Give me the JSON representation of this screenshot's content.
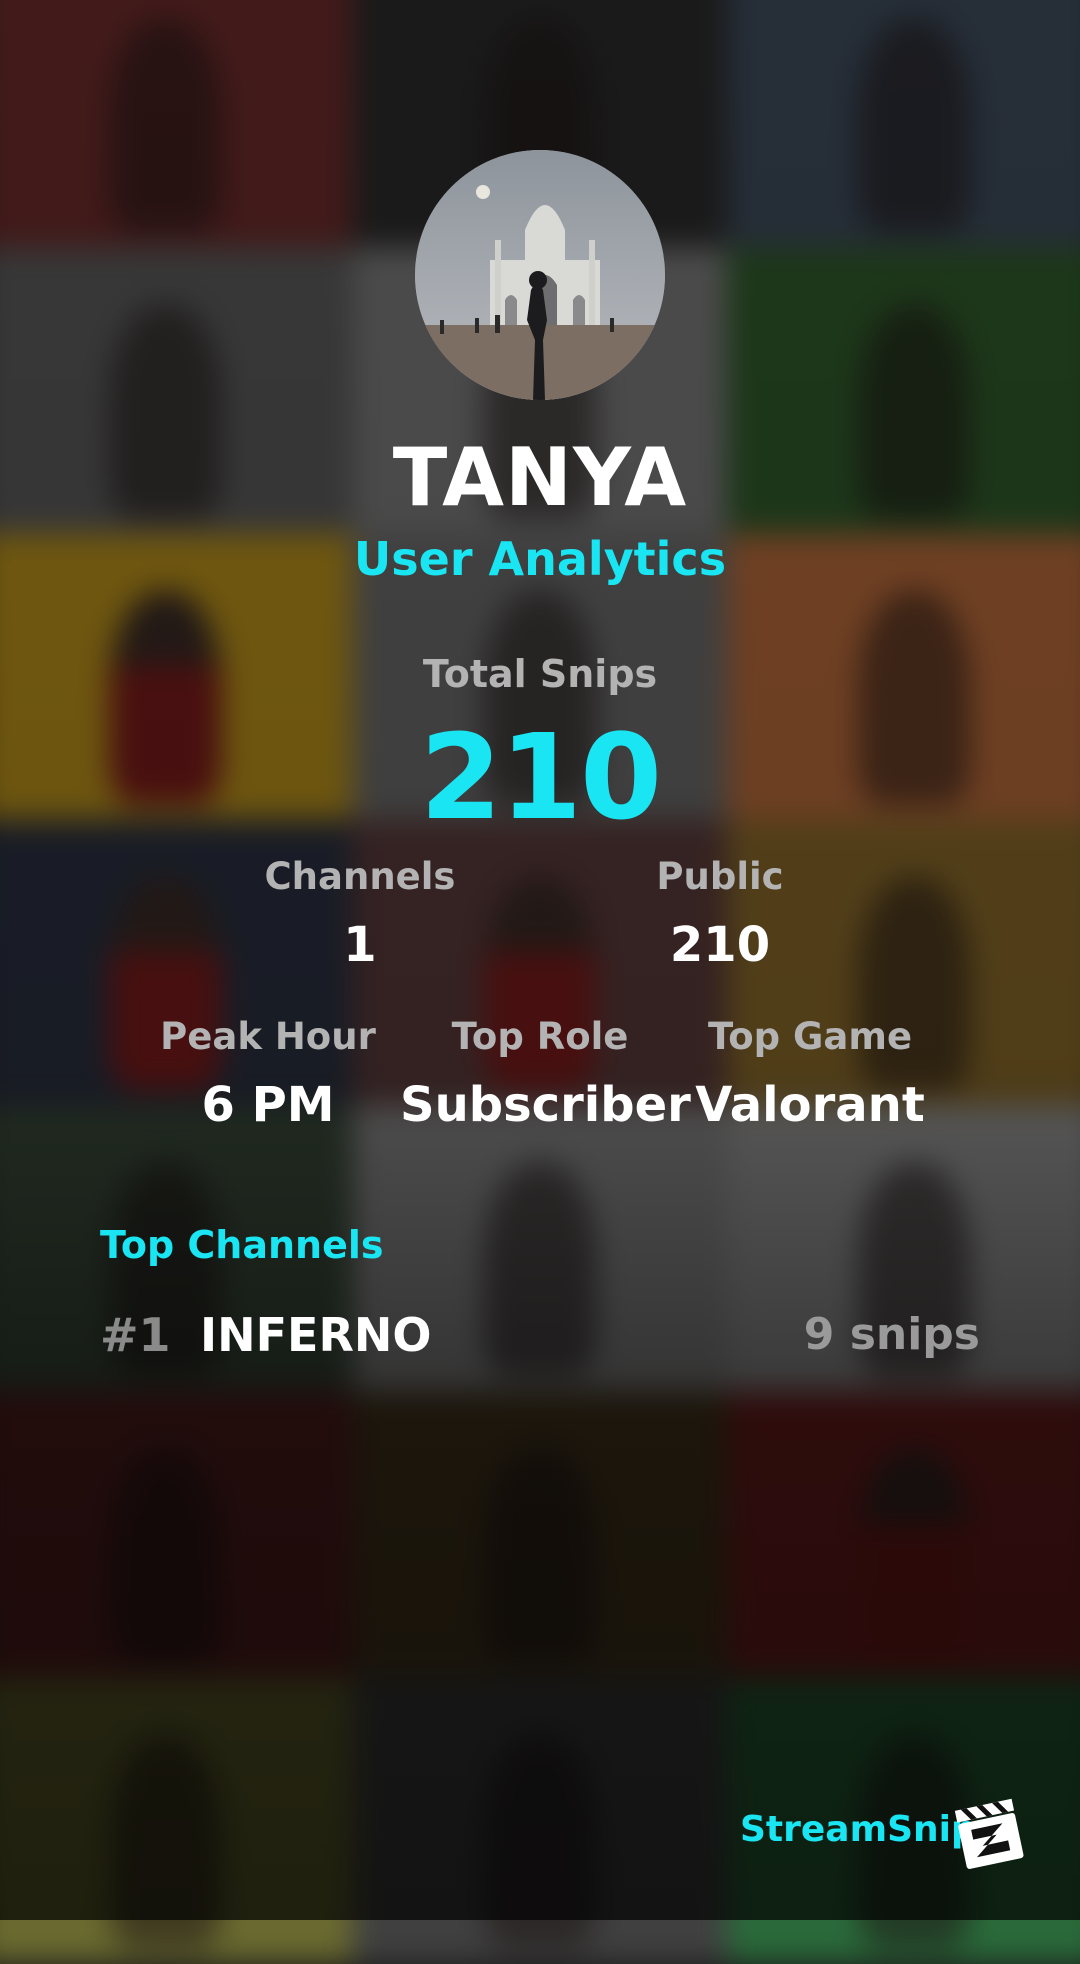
{
  "profile": {
    "name": "TANYA",
    "subtitle": "User Analytics"
  },
  "total_snips": {
    "label": "Total Snips",
    "value": "210"
  },
  "stats_row1": [
    {
      "label": "Channels",
      "value": "1"
    },
    {
      "label": "Public",
      "value": "210"
    }
  ],
  "stats_row2": [
    {
      "label": "Peak Hour",
      "value": "6 PM"
    },
    {
      "label": "Top Role",
      "value": "Subscriber"
    },
    {
      "label": "Top Game",
      "value": "Valorant"
    }
  ],
  "top_channels": {
    "title": "Top Channels",
    "items": [
      {
        "rank": "#1",
        "name": "INFERNO",
        "count": "9 snips"
      }
    ]
  },
  "brand": {
    "name": "StreamSnip",
    "logo_icon": "clapperboard-icon"
  },
  "colors": {
    "accent": "#19e6f2",
    "label_gray": "#b3b3b3",
    "text": "#ffffff"
  }
}
